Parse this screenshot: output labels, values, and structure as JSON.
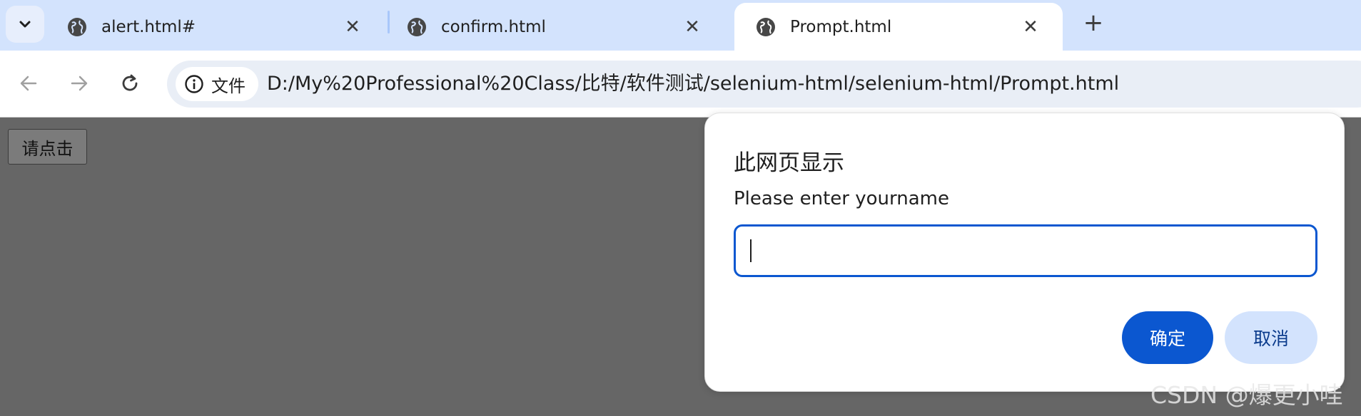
{
  "tabs": [
    {
      "title": "alert.html#",
      "close": "✕"
    },
    {
      "title": "confirm.html",
      "close": "✕"
    },
    {
      "title": "Prompt.html",
      "close": "✕",
      "active": true
    }
  ],
  "new_tab_label": "+",
  "omnibox": {
    "chip_label": "文件",
    "url": "D:/My%20Professional%20Class/比特/软件测试/selenium-html/selenium-html/Prompt.html"
  },
  "page": {
    "button_label": "请点击"
  },
  "dialog": {
    "title": "此网页显示",
    "message": "Please enter yourname",
    "input_value": "",
    "ok_label": "确定",
    "cancel_label": "取消"
  },
  "watermark": "CSDN @爆更小哇",
  "colors": {
    "tabstrip_bg": "#d3e3fd",
    "primary": "#0b57d0",
    "page_bg": "#666666"
  },
  "icons": [
    "chevron-down-icon",
    "globe-icon",
    "close-icon",
    "plus-icon",
    "back-arrow-icon",
    "forward-arrow-icon",
    "reload-icon",
    "info-icon"
  ]
}
